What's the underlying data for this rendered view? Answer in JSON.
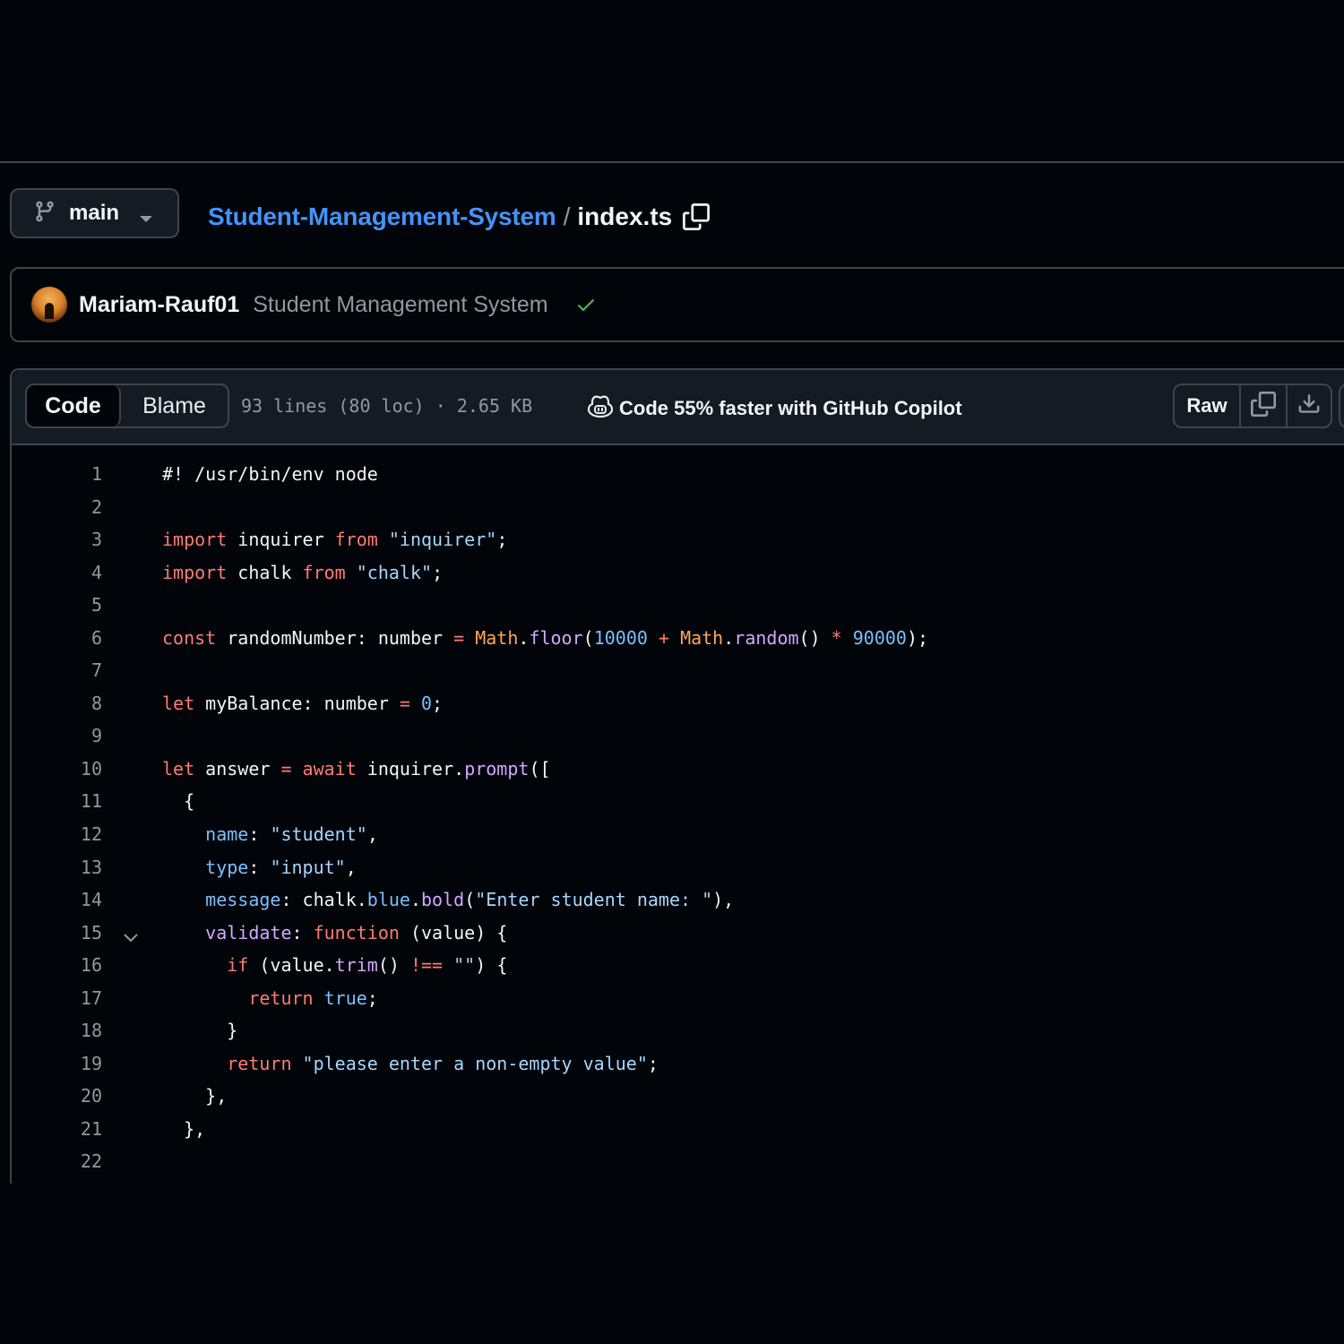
{
  "branch": {
    "name": "main",
    "icon": "git-branch-icon"
  },
  "breadcrumb": {
    "repo": "Student-Management-System",
    "separator": "/",
    "file": "index.ts"
  },
  "commit": {
    "author": "Mariam-Rauf01",
    "message": "Student Management System",
    "status": "success"
  },
  "file_header": {
    "tabs": [
      "Code",
      "Blame"
    ],
    "active_tab": "Code",
    "meta": "93 lines (80 loc) · 2.65 KB",
    "copilot_promo": "Code 55% faster with GitHub Copilot",
    "raw_label": "Raw"
  },
  "colors": {
    "background": "#010409",
    "border": "#3d444d",
    "link": "#4493f8",
    "keyword": "#ff7b72",
    "string": "#a5d6ff",
    "function": "#d2a8ff",
    "constant": "#79c0ff",
    "entity": "#ffa657",
    "success": "#3fb950"
  },
  "code_lines": [
    [
      [
        "#! /usr/bin/env node",
        ""
      ]
    ],
    [],
    [
      [
        "import",
        "k"
      ],
      [
        " inquirer ",
        ""
      ],
      [
        "from",
        "k"
      ],
      [
        " ",
        ""
      ],
      [
        "\"inquirer\"",
        "s"
      ],
      [
        ";",
        ""
      ]
    ],
    [
      [
        "import",
        "k"
      ],
      [
        " chalk ",
        ""
      ],
      [
        "from",
        "k"
      ],
      [
        " ",
        ""
      ],
      [
        "\"chalk\"",
        "s"
      ],
      [
        ";",
        ""
      ]
    ],
    [],
    [
      [
        "const",
        "k"
      ],
      [
        " randomNumber: number ",
        ""
      ],
      [
        "=",
        "k"
      ],
      [
        " ",
        ""
      ],
      [
        "Math",
        "o"
      ],
      [
        ".",
        ""
      ],
      [
        "floor",
        "f"
      ],
      [
        "(",
        ""
      ],
      [
        "10000",
        "c"
      ],
      [
        " ",
        ""
      ],
      [
        "+",
        "k"
      ],
      [
        " ",
        ""
      ],
      [
        "Math",
        "o"
      ],
      [
        ".",
        ""
      ],
      [
        "random",
        "f"
      ],
      [
        "() ",
        ""
      ],
      [
        "*",
        "k"
      ],
      [
        " ",
        ""
      ],
      [
        "90000",
        "c"
      ],
      [
        ");",
        ""
      ]
    ],
    [],
    [
      [
        "let",
        "k"
      ],
      [
        " myBalance: number ",
        ""
      ],
      [
        "=",
        "k"
      ],
      [
        " ",
        ""
      ],
      [
        "0",
        "c"
      ],
      [
        ";",
        ""
      ]
    ],
    [],
    [
      [
        "let",
        "k"
      ],
      [
        " answer ",
        ""
      ],
      [
        "=",
        "k"
      ],
      [
        " ",
        ""
      ],
      [
        "await",
        "k"
      ],
      [
        " inquirer.",
        ""
      ],
      [
        "prompt",
        "f"
      ],
      [
        "([",
        ""
      ]
    ],
    [
      [
        "  {",
        ""
      ]
    ],
    [
      [
        "    ",
        ""
      ],
      [
        "name",
        "c"
      ],
      [
        ": ",
        ""
      ],
      [
        "\"student\"",
        "s"
      ],
      [
        ",",
        ""
      ]
    ],
    [
      [
        "    ",
        ""
      ],
      [
        "type",
        "c"
      ],
      [
        ": ",
        ""
      ],
      [
        "\"input\"",
        "s"
      ],
      [
        ",",
        ""
      ]
    ],
    [
      [
        "    ",
        ""
      ],
      [
        "message",
        "c"
      ],
      [
        ": chalk.",
        ""
      ],
      [
        "blue",
        "c"
      ],
      [
        ".",
        ""
      ],
      [
        "bold",
        "f"
      ],
      [
        "(",
        ""
      ],
      [
        "\"Enter student name: \"",
        "s"
      ],
      [
        "),",
        ""
      ]
    ],
    [
      [
        "    ",
        ""
      ],
      [
        "validate",
        "f"
      ],
      [
        ": ",
        ""
      ],
      [
        "function",
        "k"
      ],
      [
        " (value) {",
        ""
      ]
    ],
    [
      [
        "      ",
        ""
      ],
      [
        "if",
        "k"
      ],
      [
        " (value.",
        ""
      ],
      [
        "trim",
        "f"
      ],
      [
        "() ",
        ""
      ],
      [
        "!==",
        "k"
      ],
      [
        " ",
        ""
      ],
      [
        "\"\"",
        "s"
      ],
      [
        ") {",
        ""
      ]
    ],
    [
      [
        "        ",
        ""
      ],
      [
        "return",
        "k"
      ],
      [
        " ",
        ""
      ],
      [
        "true",
        "c"
      ],
      [
        ";",
        ""
      ]
    ],
    [
      [
        "      }",
        ""
      ]
    ],
    [
      [
        "      ",
        ""
      ],
      [
        "return",
        "k"
      ],
      [
        " ",
        ""
      ],
      [
        "\"please enter a non-empty value\"",
        "s"
      ],
      [
        ";",
        ""
      ]
    ],
    [
      [
        "    },",
        ""
      ]
    ],
    [
      [
        "  },",
        ""
      ]
    ],
    []
  ],
  "folded_line": 15
}
